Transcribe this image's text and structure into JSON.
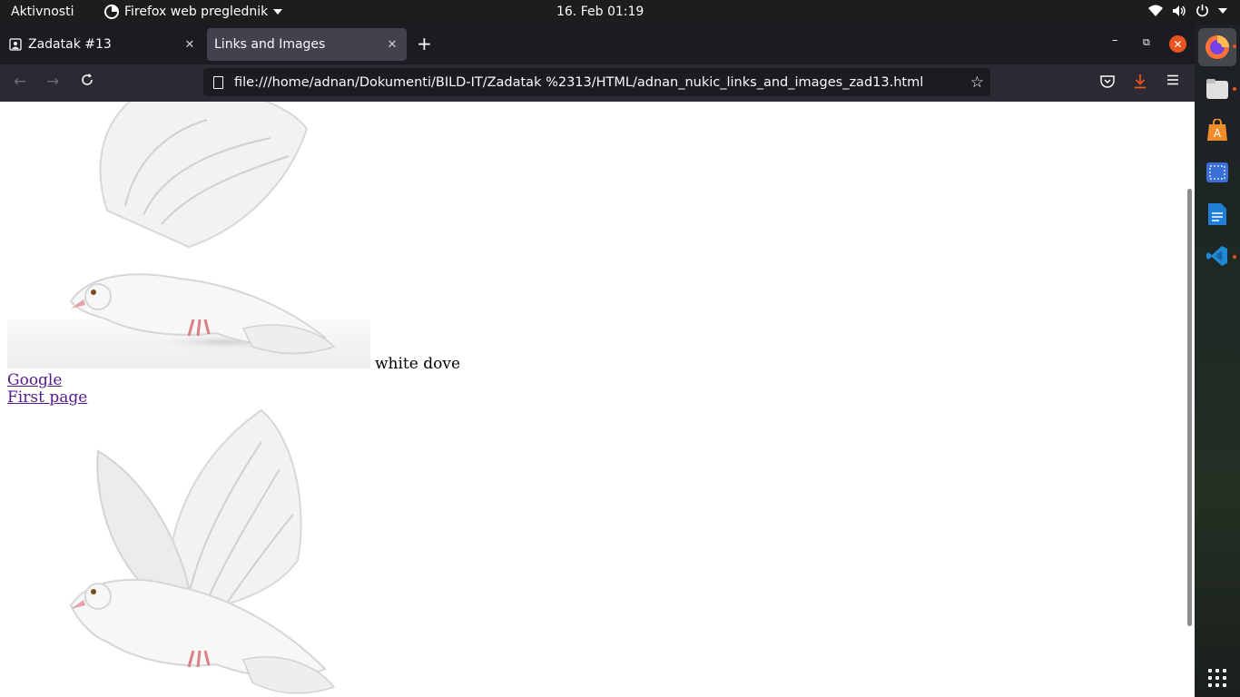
{
  "topbar": {
    "activities": "Aktivnosti",
    "app_name": "Firefox web preglednik",
    "clock": "16. Feb  01:19"
  },
  "tabs": [
    {
      "title": "Zadatak #13",
      "active": false
    },
    {
      "title": "Links and Images",
      "active": true
    }
  ],
  "navbar": {
    "url": "file:///home/adnan/Dokumenti/BILD-IT/Zadatak %2313/HTML/adnan_nukic_links_and_images_zad13.html"
  },
  "page": {
    "image_caption": "white dove",
    "links": [
      "Google",
      "First page"
    ]
  },
  "dock": {
    "apps": [
      "firefox-icon",
      "files-icon",
      "software-icon",
      "screenshot-icon",
      "writer-icon",
      "vscode-icon"
    ]
  },
  "colors": {
    "ubuntu_orange": "#e95420",
    "visited_link": "#551a8b",
    "tab_active": "#42414d",
    "tabstrip": "#1c1b22"
  }
}
